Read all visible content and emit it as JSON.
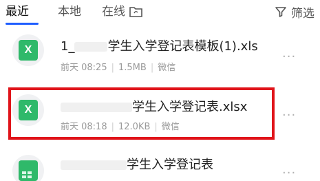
{
  "tabs": [
    {
      "label": "最近",
      "active": true
    },
    {
      "label": "本地",
      "active": false
    },
    {
      "label": "在线",
      "active": false
    }
  ],
  "filter": {
    "label": "筛选",
    "icon": "filter-icon"
  },
  "files": [
    {
      "title_prefix": "1_",
      "title_suffix": "学生入学登记表模板(1).xls",
      "time": "前天 08:25",
      "size": "1.5MB",
      "source": "微信",
      "icon": "excel-icon",
      "icon_letter": "X"
    },
    {
      "title_prefix": "",
      "title_suffix": "学生入学登记表.xlsx",
      "time": "前天 08:18",
      "size": "12.0KB",
      "source": "微信",
      "icon": "excel-icon",
      "icon_letter": "X",
      "highlighted": true
    },
    {
      "title_prefix": "",
      "title_suffix": "学生入学登记表",
      "time": "",
      "size": "",
      "source": "",
      "icon": "sheet-icon"
    }
  ],
  "more_label": "···",
  "colors": {
    "accent": "#1f5eff",
    "excel": "#2fb96a",
    "highlight": "#e0141a"
  }
}
